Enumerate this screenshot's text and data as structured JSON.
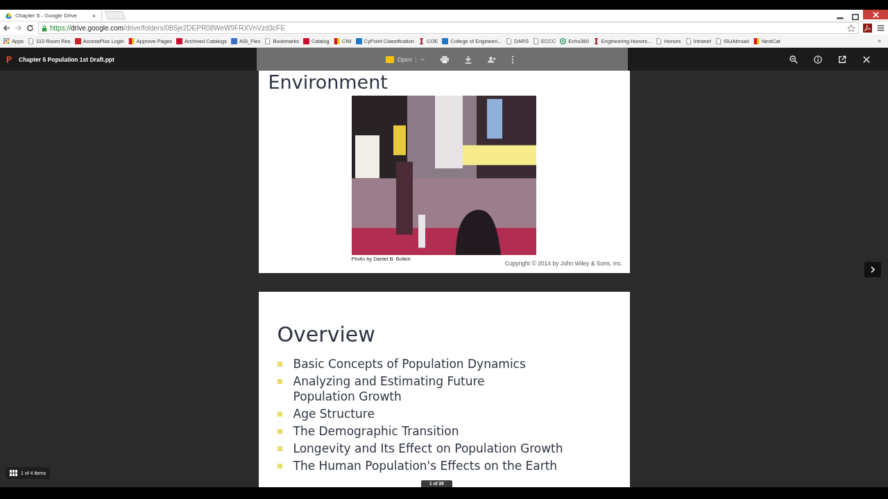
{
  "browser": {
    "tab_title": "Chapter 5 - Google Drive",
    "tab_close": "×",
    "url": {
      "scheme": "https://",
      "host": "drive.google.com",
      "path": "/drive/folders/0B5je2DEPR08WeW9FRXVnVzd3cFE"
    },
    "bookmarks": [
      {
        "label": "Apps",
        "kind": "apps"
      },
      {
        "label": "110 Room Res",
        "kind": "page"
      },
      {
        "label": "AccessPlus Login",
        "kind": "square",
        "color": "#cc1f26"
      },
      {
        "label": "Approve Pages",
        "kind": "flag"
      },
      {
        "label": "Archived Catalogs",
        "kind": "square",
        "color": "#c8102e"
      },
      {
        "label": "ASI_Flex",
        "kind": "square",
        "color": "#3a6fc4"
      },
      {
        "label": "Bookmarks",
        "kind": "page"
      },
      {
        "label": "Catalog",
        "kind": "square",
        "color": "#c8102e"
      },
      {
        "label": "CIM",
        "kind": "flag"
      },
      {
        "label": "CyPoint Classification",
        "kind": "square",
        "color": "#1f78c8"
      },
      {
        "label": "COE",
        "kind": "bar",
        "color": "#9b1c2e"
      },
      {
        "label": "College of Engineeri...",
        "kind": "square",
        "color": "#1f78c8"
      },
      {
        "label": "DARS",
        "kind": "page"
      },
      {
        "label": "ECCC",
        "kind": "page"
      },
      {
        "label": "Echo360",
        "kind": "circle",
        "color": "#2e9e6a"
      },
      {
        "label": "Engineering Honors...",
        "kind": "bar",
        "color": "#9b1c2e"
      },
      {
        "label": "Honors",
        "kind": "page"
      },
      {
        "label": "Intranet",
        "kind": "page"
      },
      {
        "label": "ISUAbroad",
        "kind": "page"
      },
      {
        "label": "NextCat",
        "kind": "flag"
      }
    ],
    "more": "»"
  },
  "viewer": {
    "file_name": "Chapter 5 Population 1st Draft.ppt",
    "open_label": "Open",
    "items_count": "1 of 4 items",
    "page_count": "1 of 39",
    "slides": [
      {
        "title": "Environment",
        "credit": "Photo by Daniel B. Botkin",
        "copyright": "Copyright © 2014 by John Wiley & Sons, Inc."
      },
      {
        "kind": "bullets",
        "title": "Overview",
        "bullets": [
          "Basic Concepts of Population Dynamics",
          "Analyzing and Estimating Future Population Growth",
          "Age Structure",
          "The Demographic Transition",
          "Longevity and Its Effect on Population Growth",
          "The Human Population's Effects on the Earth"
        ]
      }
    ]
  }
}
